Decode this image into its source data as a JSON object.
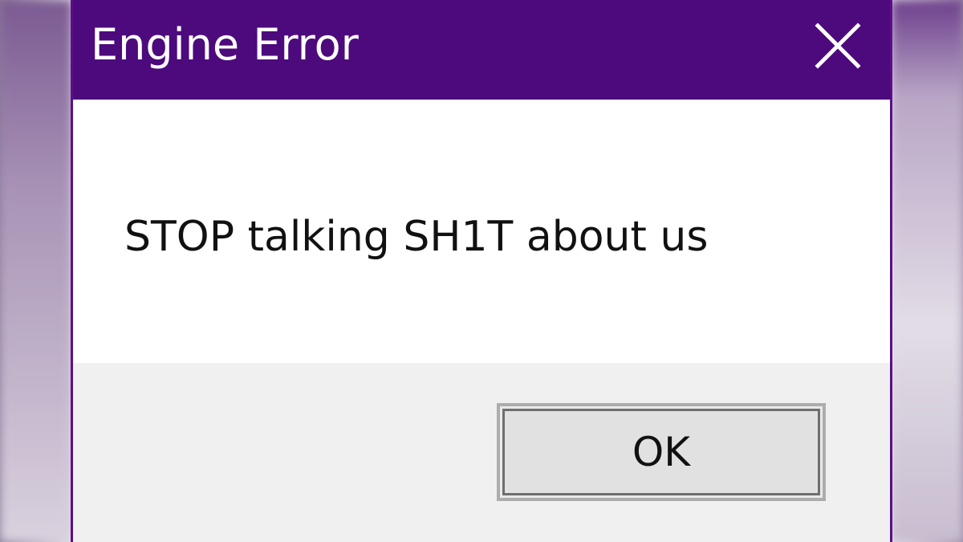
{
  "dialog": {
    "title": "Engine Error",
    "message": "STOP talking SH1T about us",
    "ok_label": "OK",
    "close_icon": "close-icon"
  },
  "colors": {
    "titlebar": "#4c0a7c",
    "title_text": "#ffffff",
    "content_bg": "#ffffff",
    "footer_bg": "#f0f0f0",
    "button_bg": "#e1e1e1"
  }
}
